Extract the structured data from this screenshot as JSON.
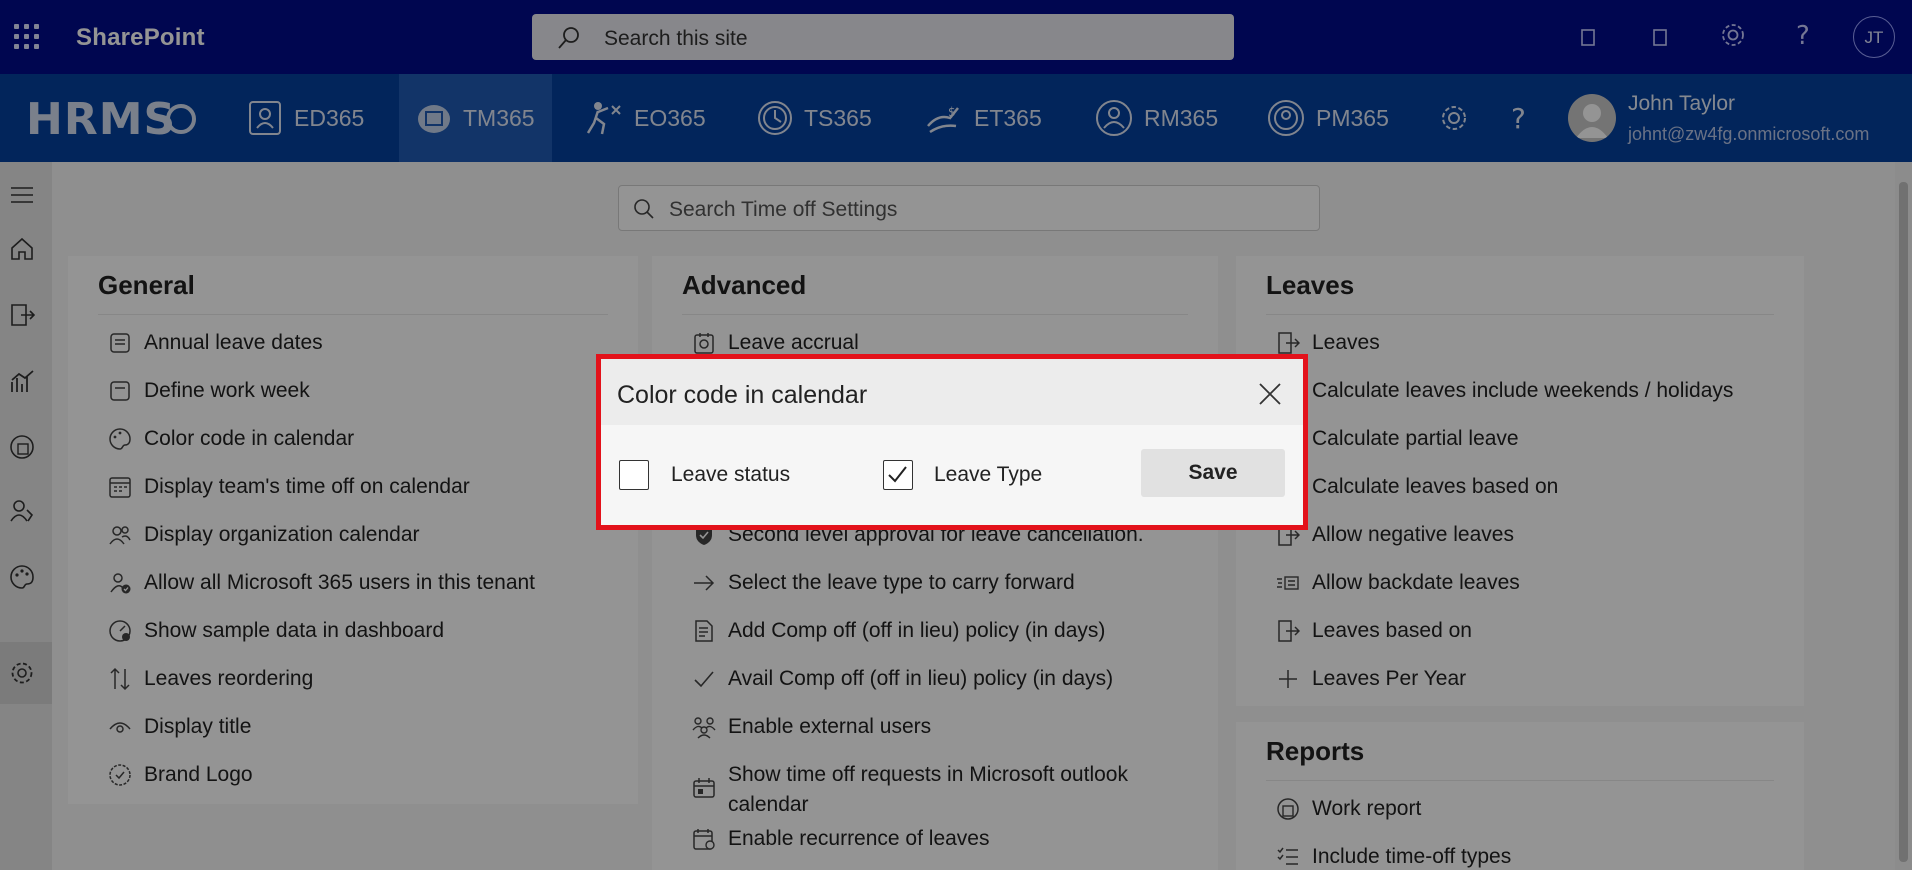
{
  "suite": {
    "app_name": "SharePoint",
    "search_placeholder": "Search this site",
    "avatar_initials": "JT"
  },
  "appbar": {
    "logo": "HRMS",
    "items": [
      {
        "label": "ED365",
        "icon": "id-badge-icon"
      },
      {
        "label": "TM365",
        "icon": "calendar-icon",
        "active": true
      },
      {
        "label": "EO365",
        "icon": "onboarding-icon"
      },
      {
        "label": "TS365",
        "icon": "clock-icon"
      },
      {
        "label": "ET365",
        "icon": "expense-icon"
      },
      {
        "label": "RM365",
        "icon": "recruit-icon"
      },
      {
        "label": "PM365",
        "icon": "performance-icon"
      }
    ],
    "user_name": "John Taylor",
    "user_email": "johnt@zw4fg.onmicrosoft.com"
  },
  "search_settings_placeholder": "Search Time off Settings",
  "general": {
    "title": "General",
    "items": [
      "Annual leave dates",
      "Define work week",
      "Color code in calendar",
      "Display team's time off on calendar",
      "Display organization calendar",
      "Allow all Microsoft 365 users in this tenant",
      "Show sample data in dashboard",
      "Leaves reordering",
      "Display title",
      "Brand Logo"
    ]
  },
  "advanced": {
    "title": "Advanced",
    "items": [
      "Leave accrual",
      "Second level approval for leave cancellation.",
      "Select the leave type to carry forward",
      "Add Comp off (off in lieu) policy (in days)",
      "Avail Comp off (off in lieu) policy (in days)",
      "Enable external users",
      "Show time off requests in Microsoft outlook calendar",
      "Enable recurrence of leaves"
    ]
  },
  "leaves": {
    "title": "Leaves",
    "items": [
      "Leaves",
      "Calculate leaves include weekends / holidays",
      "Calculate partial leave",
      "Calculate leaves based on",
      "Allow negative leaves",
      "Allow backdate leaves",
      "Leaves based on",
      "Leaves Per Year"
    ]
  },
  "reports": {
    "title": "Reports",
    "items": [
      "Work report",
      "Include time-off types"
    ]
  },
  "dialog": {
    "title": "Color code in calendar",
    "option1_label": "Leave status",
    "option1_checked": false,
    "option2_label": "Leave Type",
    "option2_checked": true,
    "save_label": "Save"
  },
  "colors": {
    "suitebar": "#010c8a",
    "appbar": "#04409e",
    "highlight_border": "#e3121b"
  }
}
